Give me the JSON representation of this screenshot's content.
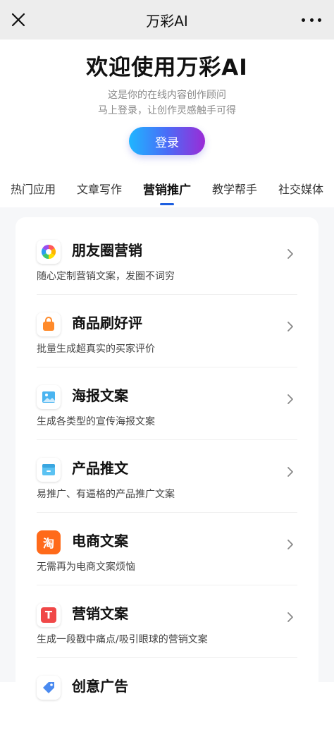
{
  "header": {
    "title": "万彩AI",
    "close_icon": "close-icon",
    "more_icon": "more-icon"
  },
  "hero": {
    "title": "欢迎使用万彩AI",
    "line1": "这是你的在线内容创作顾问",
    "line2": "马上登录，让创作灵感触手可得",
    "login_label": "登录"
  },
  "tabs": [
    {
      "label": "热门应用"
    },
    {
      "label": "文章写作"
    },
    {
      "label": "营销推广",
      "active": true
    },
    {
      "label": "教学帮手"
    },
    {
      "label": "社交媒体"
    }
  ],
  "items": [
    {
      "name": "朋友圈营销",
      "desc": "随心定制营销文案，发圈不词穷",
      "icon": "aperture-icon"
    },
    {
      "name": "商品刷好评",
      "desc": "批量生成超真实的买家评价",
      "icon": "shopping-bag-icon"
    },
    {
      "name": "海报文案",
      "desc": "生成各类型的宣传海报文案",
      "icon": "image-icon"
    },
    {
      "name": "产品推文",
      "desc": "易推广、有逼格的产品推广文案",
      "icon": "box-icon"
    },
    {
      "name": "电商文案",
      "desc": "无需再为电商文案烦恼",
      "icon": "tao-icon",
      "glyph": "淘"
    },
    {
      "name": "营销文案",
      "desc": "生成一段戳中痛点/吸引眼球的营销文案",
      "icon": "text-icon",
      "glyph": "T"
    },
    {
      "name": "创意广告",
      "desc": "",
      "icon": "tag-icon"
    }
  ],
  "colors": {
    "accent": "#1e5fe0",
    "gradient_start": "#1fb6ff",
    "gradient_end": "#9b2bd6"
  }
}
